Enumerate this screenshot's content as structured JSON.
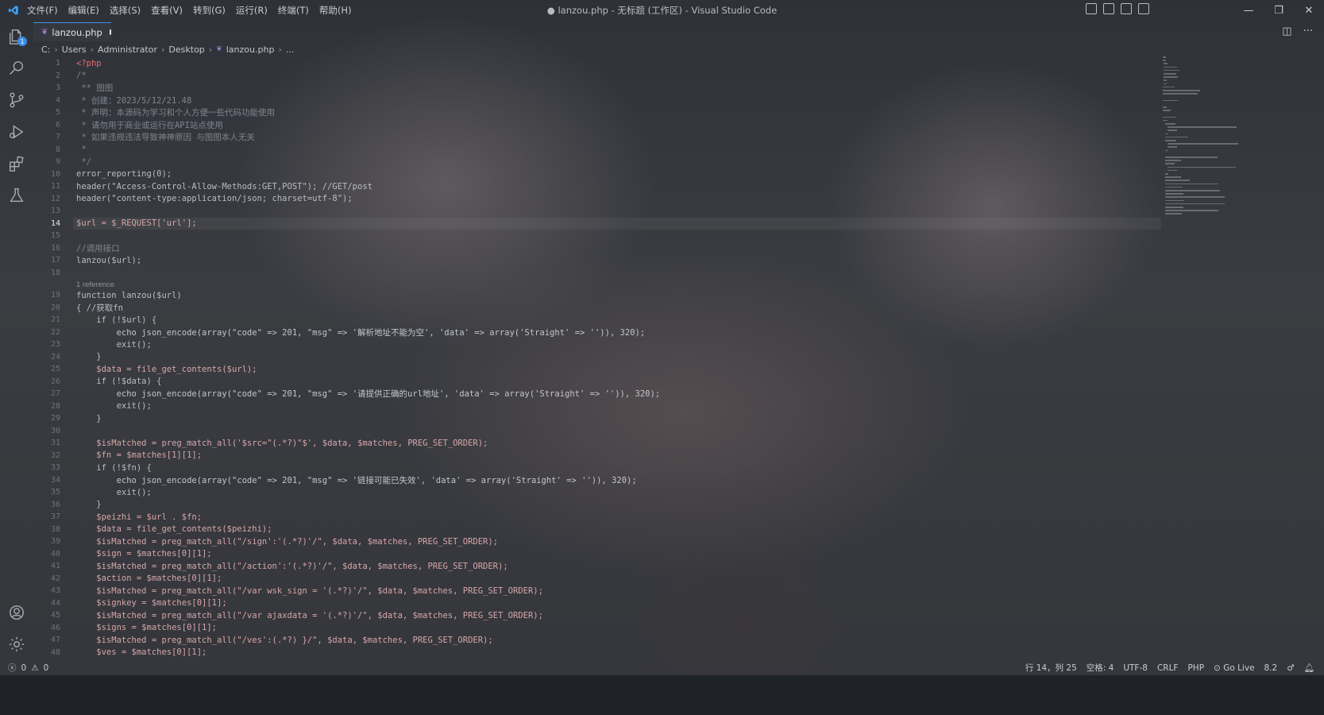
{
  "titlebar": {
    "menu": [
      "文件(F)",
      "编辑(E)",
      "选择(S)",
      "查看(V)",
      "转到(G)",
      "运行(R)",
      "终端(T)",
      "帮助(H)"
    ],
    "window_title": "● lanzou.php - 无标题 (工作区) - Visual Studio Code",
    "controls": [
      "—",
      "❐",
      "✕"
    ]
  },
  "activity": {
    "explorer_badge": "1"
  },
  "tab": {
    "label": "lanzou.php"
  },
  "breadcrumb": [
    "C:",
    "Users",
    "Administrator",
    "Desktop",
    "lanzou.php",
    "..."
  ],
  "editor": {
    "active_line": 14,
    "codelens": "1 reference",
    "lines": [
      {
        "n": "1",
        "t": "<?php"
      },
      {
        "n": "2",
        "t": "/*"
      },
      {
        "n": "3",
        "t": " ** 图图"
      },
      {
        "n": "4",
        "t": " * 创建：2023/5/12/21.48"
      },
      {
        "n": "5",
        "t": " * 声明：本源码为学习和个人方便一些代码功能使用"
      },
      {
        "n": "6",
        "t": " * 请勿用于商业或运行在API站点使用"
      },
      {
        "n": "7",
        "t": " * 如果违规违法导致神神原因 与图图本人无关"
      },
      {
        "n": "8",
        "t": " *"
      },
      {
        "n": "9",
        "t": " */"
      },
      {
        "n": "10",
        "t": "error_reporting(0);"
      },
      {
        "n": "11",
        "t": "header(\"Access-Control-Allow-Methods:GET,POST\"); //GET/post"
      },
      {
        "n": "12",
        "t": "header(\"content-type:application/json; charset=utf-8\");"
      },
      {
        "n": "13",
        "t": ""
      },
      {
        "n": "14",
        "t": "$url = $_REQUEST['url'];"
      },
      {
        "n": "15",
        "t": ""
      },
      {
        "n": "16",
        "t": "//调用接口"
      },
      {
        "n": "17",
        "t": "lanzou($url);"
      },
      {
        "n": "18",
        "t": ""
      },
      {
        "n": "19",
        "t": "function lanzou($url)"
      },
      {
        "n": "20",
        "t": "{ //获取fn"
      },
      {
        "n": "21",
        "t": "    if (!$url) {"
      },
      {
        "n": "22",
        "t": "        echo json_encode(array(\"code\" => 201, \"msg\" => '解析地址不能为空', 'data' => array('Straight' => '')), 320);"
      },
      {
        "n": "23",
        "t": "        exit();"
      },
      {
        "n": "24",
        "t": "    }"
      },
      {
        "n": "25",
        "t": "    $data = file_get_contents($url);"
      },
      {
        "n": "26",
        "t": "    if (!$data) {"
      },
      {
        "n": "27",
        "t": "        echo json_encode(array(\"code\" => 201, \"msg\" => '请提供正确的url地址', 'data' => array('Straight' => '')), 320);"
      },
      {
        "n": "28",
        "t": "        exit();"
      },
      {
        "n": "29",
        "t": "    }"
      },
      {
        "n": "30",
        "t": ""
      },
      {
        "n": "31",
        "t": "    $isMatched = preg_match_all('$src=\"(.*?)\"$', $data, $matches, PREG_SET_ORDER);"
      },
      {
        "n": "32",
        "t": "    $fn = $matches[1][1];"
      },
      {
        "n": "33",
        "t": "    if (!$fn) {"
      },
      {
        "n": "34",
        "t": "        echo json_encode(array(\"code\" => 201, \"msg\" => '链接可能已失效', 'data' => array('Straight' => '')), 320);"
      },
      {
        "n": "35",
        "t": "        exit();"
      },
      {
        "n": "36",
        "t": "    }"
      },
      {
        "n": "37",
        "t": "    $peizhi = $url . $fn;"
      },
      {
        "n": "38",
        "t": "    $data = file_get_contents($peizhi);"
      },
      {
        "n": "39",
        "t": "    $isMatched = preg_match_all(\"/sign':'(.*?)'/\", $data, $matches, PREG_SET_ORDER);"
      },
      {
        "n": "40",
        "t": "    $sign = $matches[0][1];"
      },
      {
        "n": "41",
        "t": "    $isMatched = preg_match_all(\"/action':'(.*?)'/\", $data, $matches, PREG_SET_ORDER);"
      },
      {
        "n": "42",
        "t": "    $action = $matches[0][1];"
      },
      {
        "n": "43",
        "t": "    $isMatched = preg_match_all(\"/var wsk_sign = '(.*?)'/\", $data, $matches, PREG_SET_ORDER);"
      },
      {
        "n": "44",
        "t": "    $signkey = $matches[0][1];"
      },
      {
        "n": "45",
        "t": "    $isMatched = preg_match_all(\"/var ajaxdata = '(.*?)'/\", $data, $matches, PREG_SET_ORDER);"
      },
      {
        "n": "46",
        "t": "    $signs = $matches[0][1];"
      },
      {
        "n": "47",
        "t": "    $isMatched = preg_match_all(\"/ves':(.*?) }/\", $data, $matches, PREG_SET_ORDER);"
      },
      {
        "n": "48",
        "t": "    $ves = $matches[0][1];"
      }
    ]
  },
  "status": {
    "errors": "0",
    "warnings": "0",
    "position": "行 14，列 25",
    "spaces": "空格: 4",
    "encoding": "UTF-8",
    "eol": "CRLF",
    "language": "PHP",
    "golive": "Go Live",
    "version": "8.2"
  }
}
